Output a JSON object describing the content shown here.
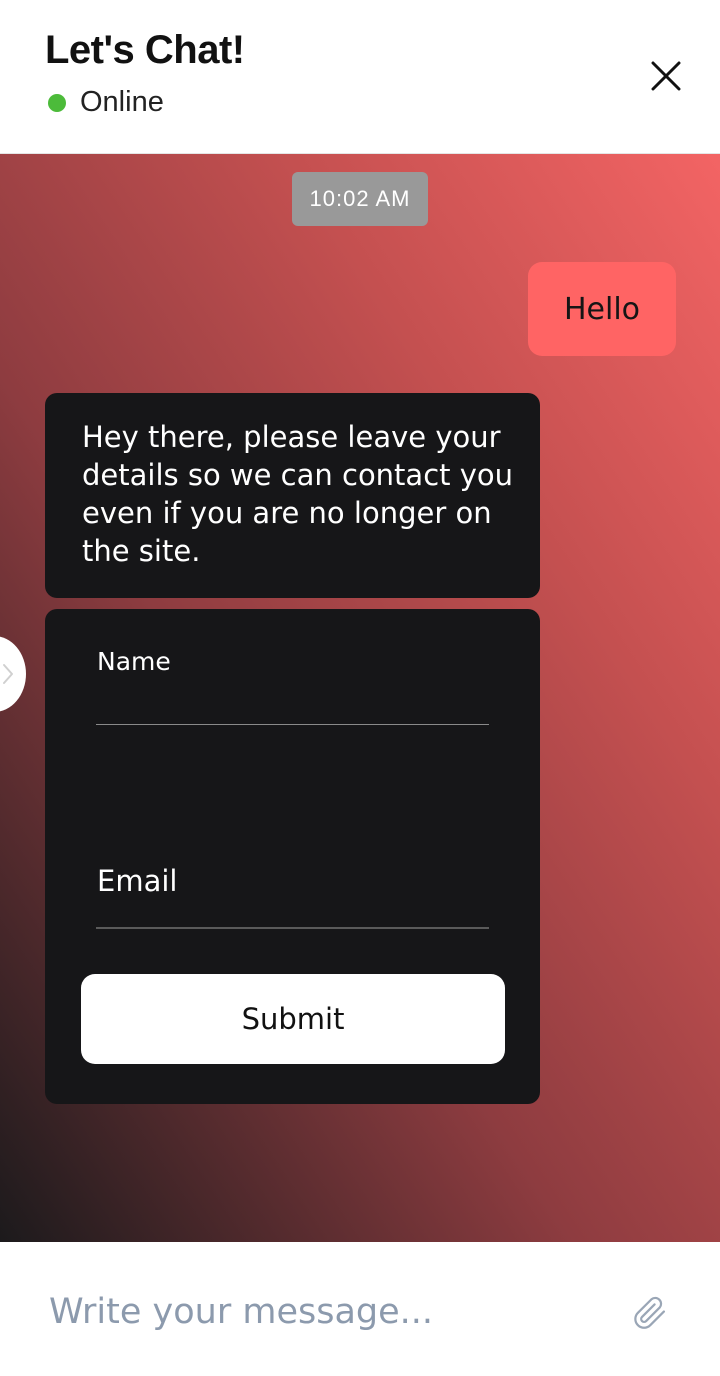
{
  "header": {
    "title": "Let's Chat!",
    "status_text": "Online",
    "status_color": "#4cbb3a",
    "close_icon": "close-icon"
  },
  "chat": {
    "background_gradient": [
      "#f36464",
      "#c45050",
      "#8e3c40",
      "#1c1a1c"
    ],
    "timestamp": "10:02 AM",
    "timestamp_bg": "#999999",
    "messages": [
      {
        "from": "user",
        "text": "Hello",
        "bg": "#ff6464"
      },
      {
        "from": "bot",
        "text": "Hey there, please leave your details so we can contact you even if you are no longer on the site."
      }
    ],
    "form": {
      "name_label": "Name",
      "name_value": "",
      "email_label": "Email",
      "email_value": "",
      "submit_label": "Submit"
    },
    "side_tab_icon": "chevron-right-icon"
  },
  "composer": {
    "placeholder": "Write your message...",
    "attach_icon": "paperclip-icon"
  }
}
